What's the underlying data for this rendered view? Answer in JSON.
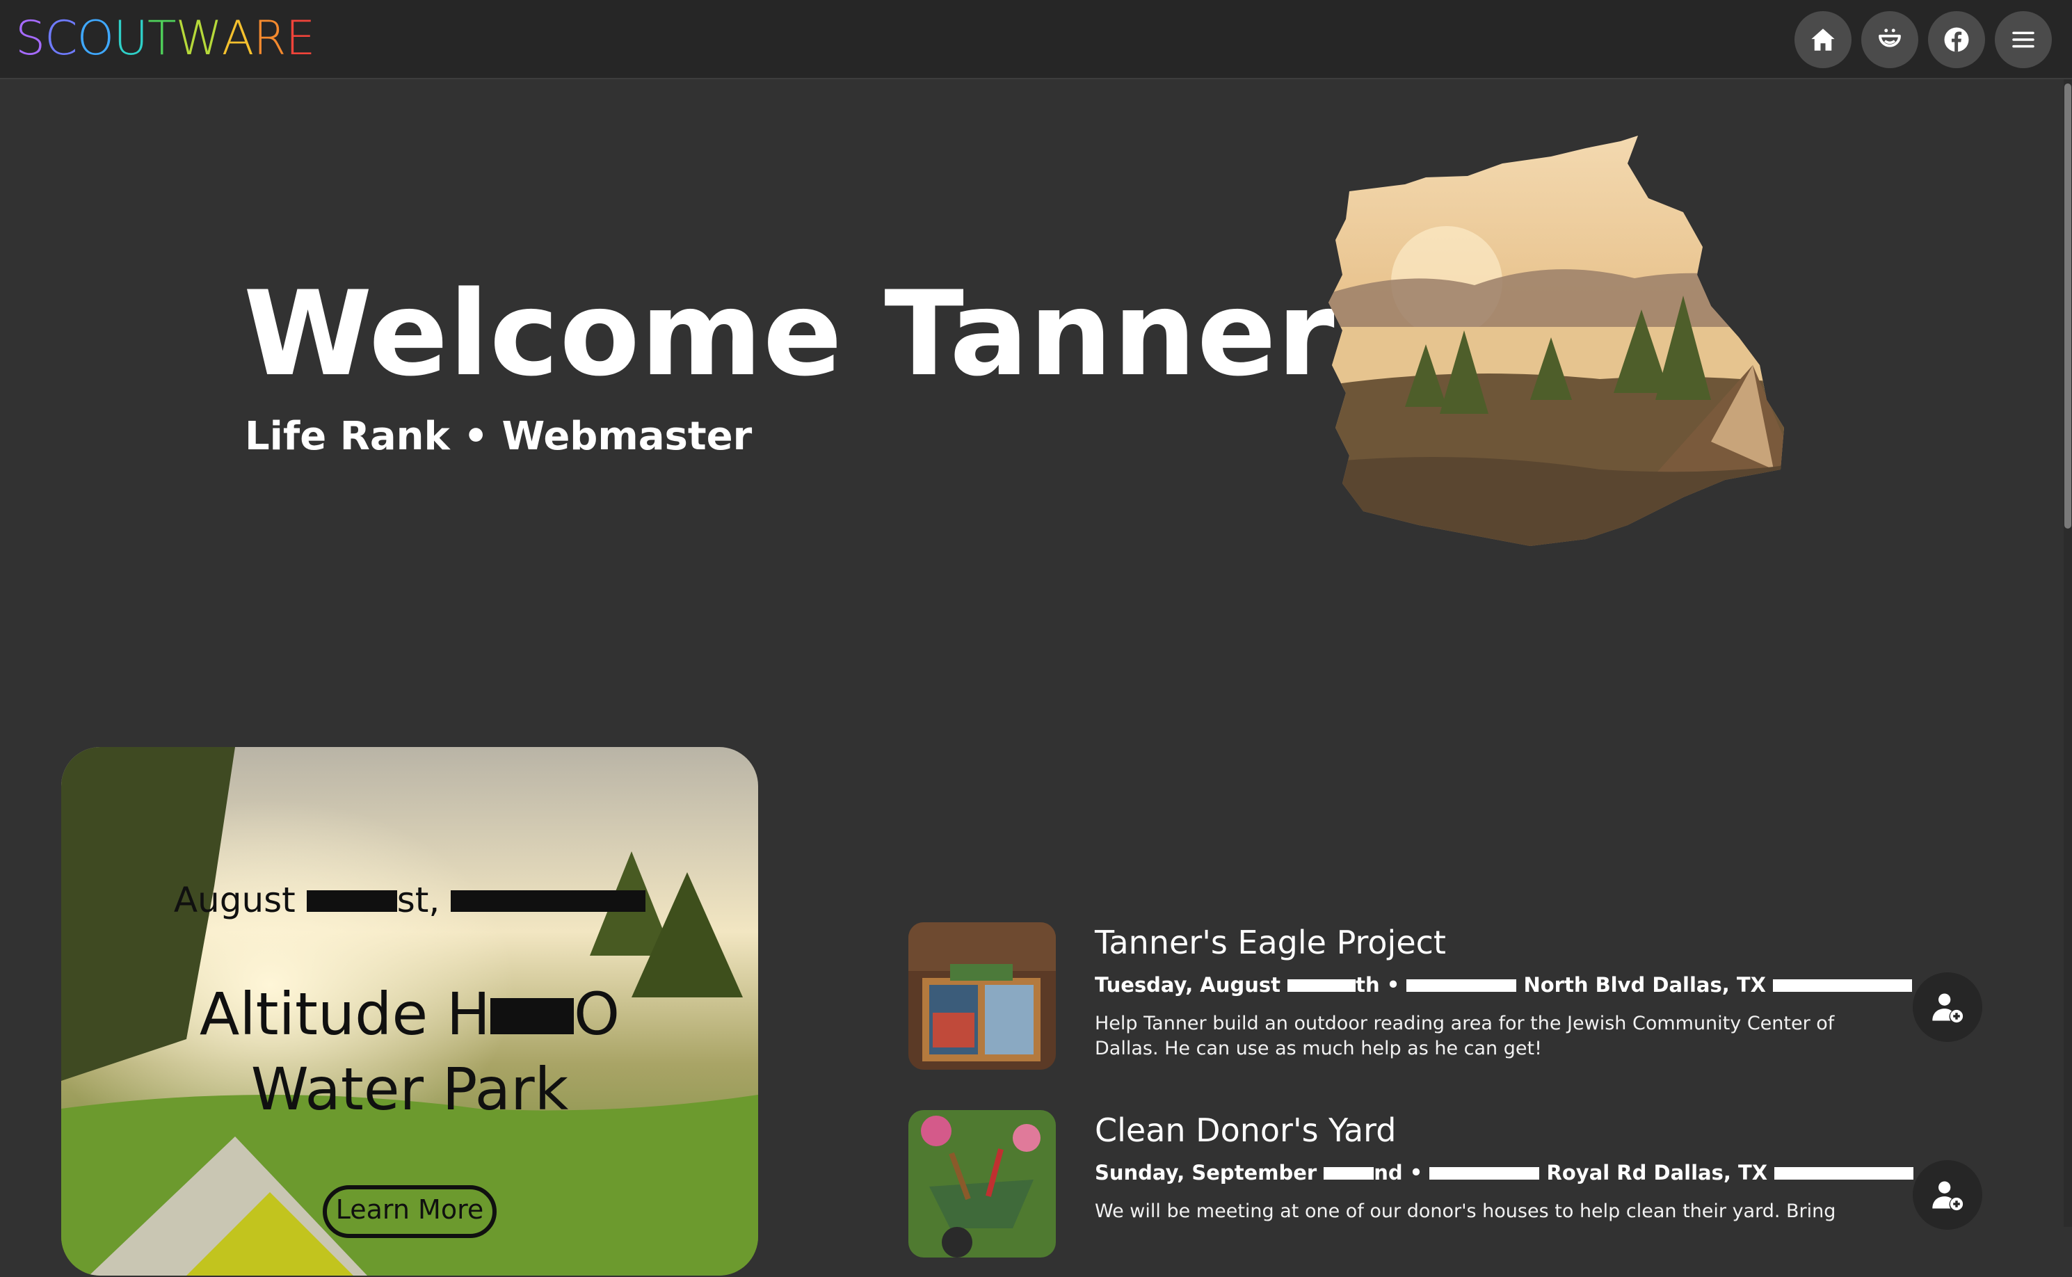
{
  "header": {
    "logo_letters": [
      "S",
      "C",
      "O",
      "U",
      "T",
      "W",
      "A",
      "R",
      "E"
    ],
    "logo_colors": [
      "#a66bff",
      "#6f7bff",
      "#3fa8ff",
      "#2fd0c8",
      "#4fd05a",
      "#b6d93a",
      "#f5c12e",
      "#f58a2e",
      "#f0443a"
    ],
    "nav": [
      {
        "name": "home-icon"
      },
      {
        "name": "smile-icon"
      },
      {
        "name": "facebook-icon"
      },
      {
        "name": "menu-icon"
      }
    ]
  },
  "hero": {
    "welcome": "Welcome Tanner",
    "rank": "Life Rank",
    "separator": "•",
    "role": "Webmaster"
  },
  "featured": {
    "date_part1": "August",
    "date_part2": "st,",
    "title_part1": "Altitude H",
    "title_part2": "O",
    "title_line2": "Water Park",
    "learn_more": "Learn More"
  },
  "events": [
    {
      "title": "Tanner's Eagle Project",
      "meta_part1": "Tuesday, August",
      "meta_part2": "th •",
      "meta_part3": "North Blvd Dallas, TX",
      "description": "Help Tanner build an outdoor reading area for the Jewish Community Center of Dallas. He can use as much help as he can get!"
    },
    {
      "title": "Clean Donor's Yard",
      "meta_part1": "Sunday, September",
      "meta_part2": "nd •",
      "meta_part3": "Royal Rd Dallas, TX",
      "description": "We will be meeting at one of our donor's houses to help clean their yard. Bring"
    }
  ]
}
